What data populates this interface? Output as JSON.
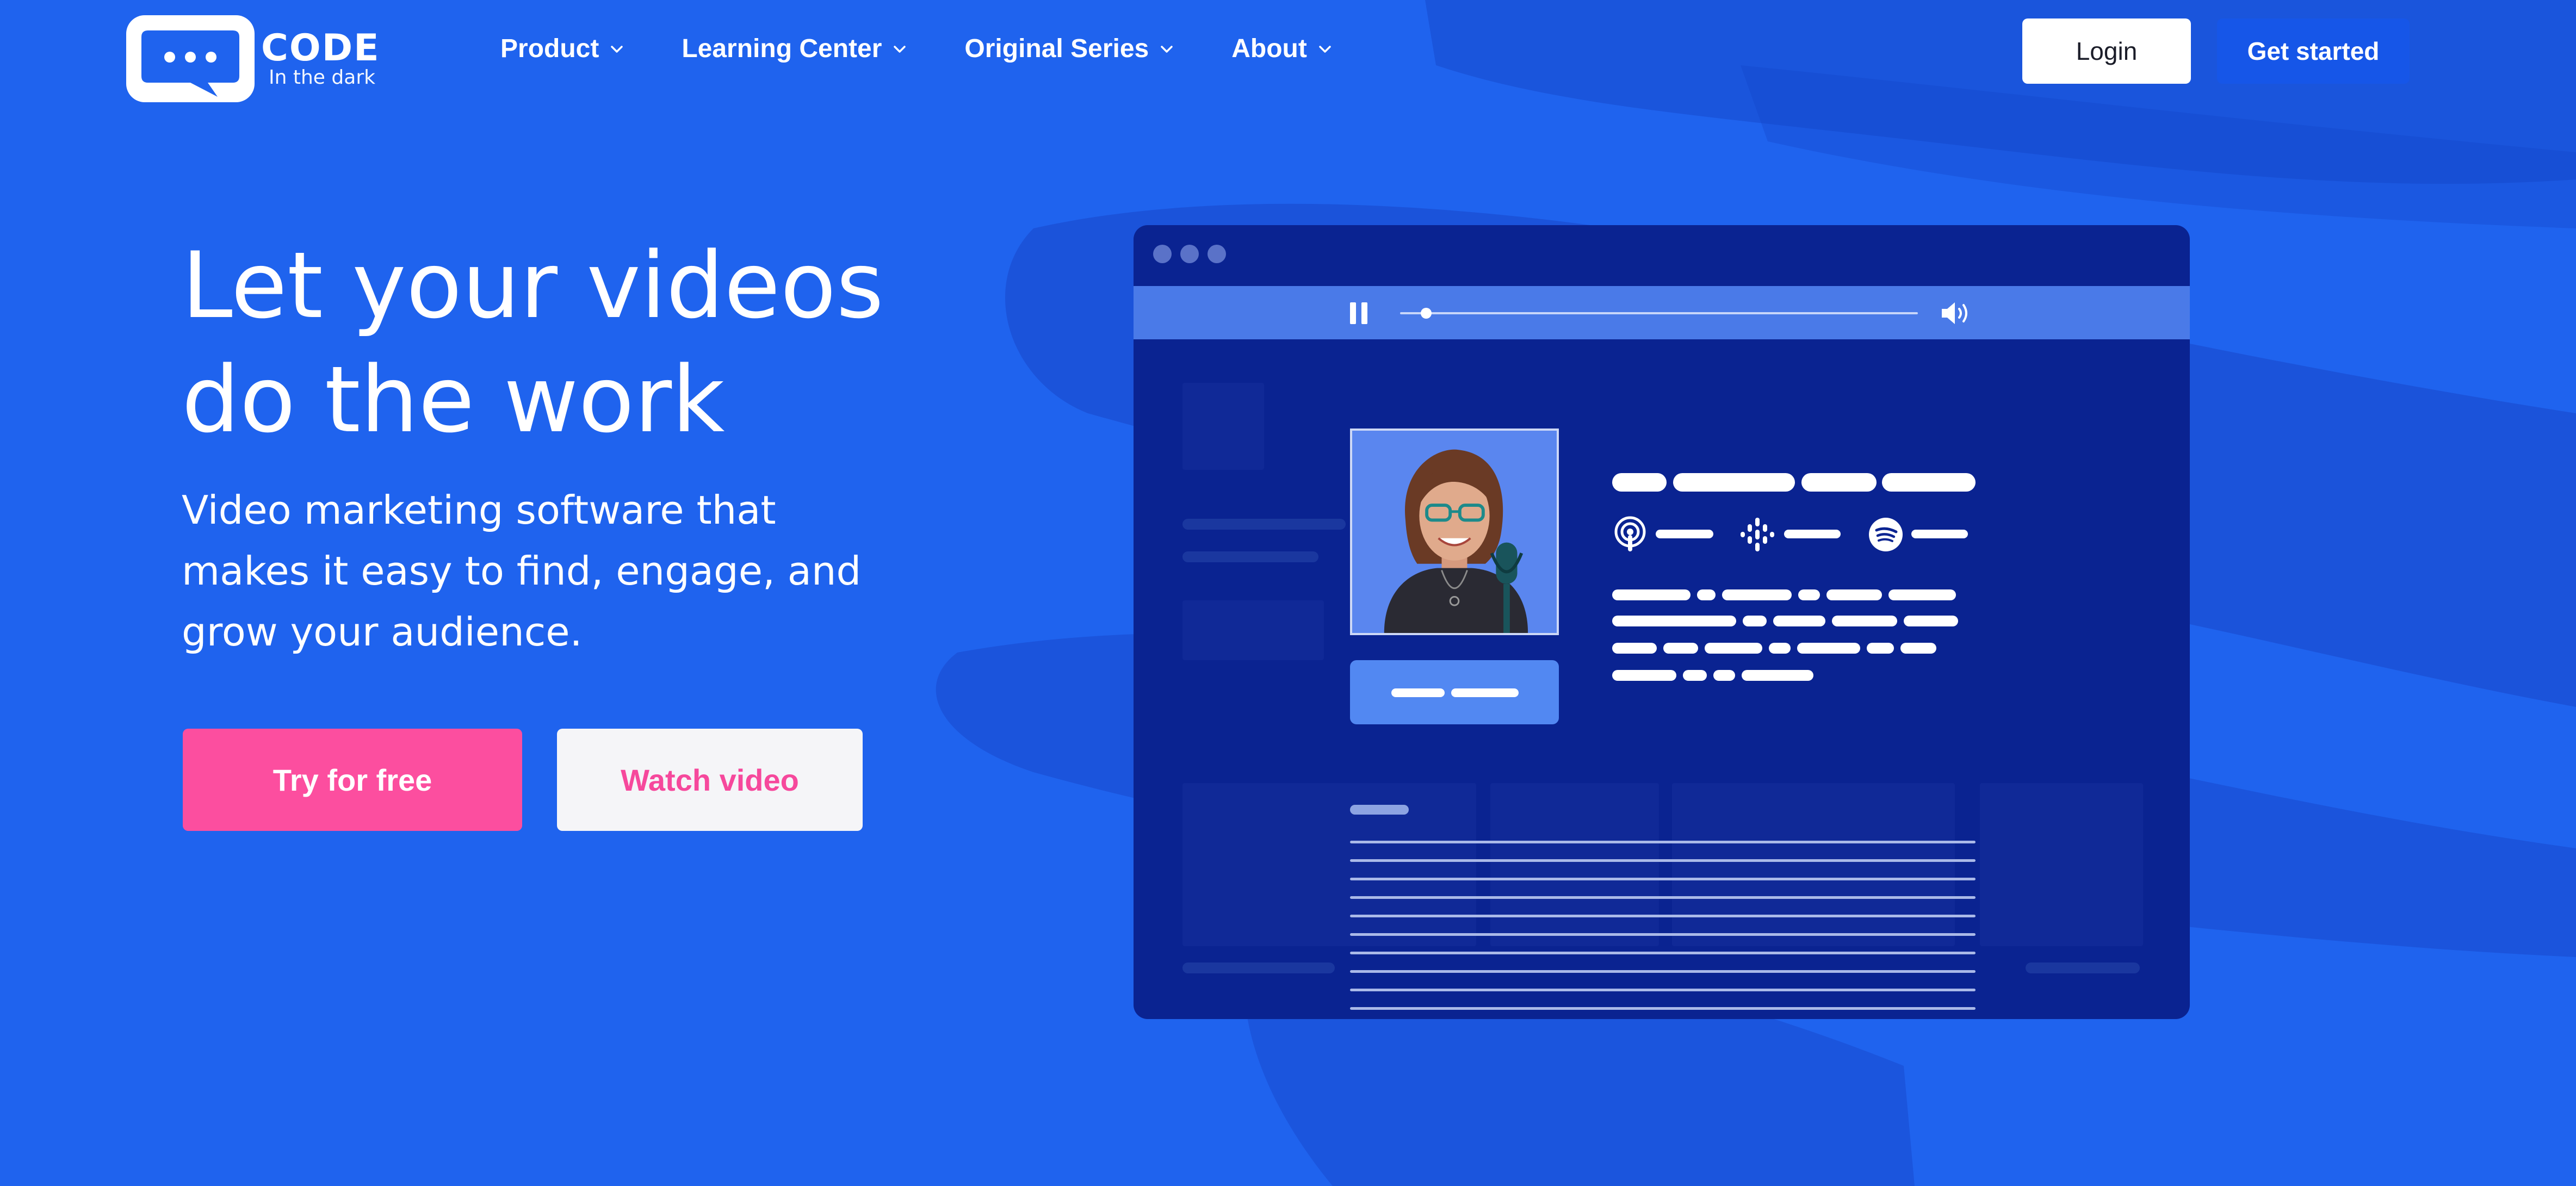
{
  "brand": {
    "name": "CODE",
    "tagline": "In the dark",
    "logo_icon": "speech-bubble-dots-icon"
  },
  "nav": {
    "items": [
      {
        "label": "Product",
        "icon": "chevron-down-icon"
      },
      {
        "label": "Learning Center",
        "icon": "chevron-down-icon"
      },
      {
        "label": "Original Series",
        "icon": "chevron-down-icon"
      },
      {
        "label": "About",
        "icon": "chevron-down-icon"
      }
    ],
    "login_label": "Login",
    "get_started_label": "Get started"
  },
  "hero": {
    "title_line1": "Let your videos",
    "title_line2": "do the work",
    "subtitle_line1": "Video marketing software that",
    "subtitle_line2": "makes it easy to find, engage, and",
    "subtitle_line3": "grow your audience.",
    "primary_cta": "Try for free",
    "secondary_cta": "Watch video"
  },
  "player": {
    "controls": [
      "pause-icon",
      "progress-slider",
      "volume-icon"
    ],
    "platform_icons": [
      "apple-podcasts-icon",
      "google-podcasts-icon",
      "spotify-icon"
    ],
    "progress": 0.05
  },
  "colors": {
    "background": "#1f63ee",
    "accent_pink": "#fc4e9f",
    "player_bg": "#0a2391",
    "control_bar": "#4a7ae8",
    "get_started_bg": "#1656e8"
  }
}
